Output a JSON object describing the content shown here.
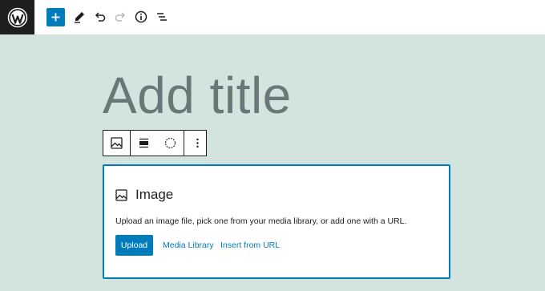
{
  "toolbar": {
    "logo_icon": "wordpress-logo-icon",
    "icons": [
      "add-block-icon",
      "edit-pencil-icon",
      "undo-icon",
      "redo-icon",
      "info-icon",
      "list-view-icon"
    ],
    "accent_color": "#007cba"
  },
  "editor": {
    "title_placeholder": "Add title",
    "background_color": "#d3e4de"
  },
  "block_toolbar": {
    "icons": [
      "image-block-icon",
      "align-icon",
      "duotone-icon",
      "more-options-icon"
    ]
  },
  "image_block": {
    "label": "Image",
    "instructions": "Upload an image file, pick one from your media library, or add one with a URL.",
    "upload_label": "Upload",
    "media_library_label": "Media Library",
    "insert_url_label": "Insert from URL"
  }
}
